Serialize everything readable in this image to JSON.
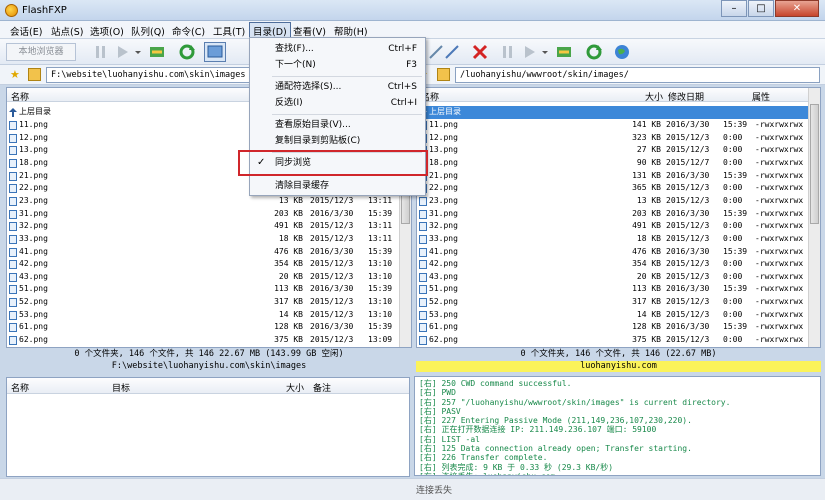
{
  "window": {
    "title": "FlashFXP"
  },
  "menu": [
    "会话(E)",
    "站点(S)",
    "选项(O)",
    "队列(Q)",
    "命令(C)",
    "工具(T)",
    "目录(D)",
    "查看(V)",
    "帮助(H)"
  ],
  "toolbar": {
    "local_browser_label": "本地浏览器"
  },
  "left": {
    "path": "F:\\website\\luohanyishu.com\\skin\\images",
    "col_name": "名称",
    "parent": "上层目录",
    "files": [
      {
        "name": "11.png",
        "size": "",
        "date": "",
        "time": ""
      },
      {
        "name": "12.png",
        "size": "",
        "date": "",
        "time": ""
      },
      {
        "name": "13.png",
        "size": "",
        "date": "",
        "time": ""
      },
      {
        "name": "18.png",
        "size": "",
        "date": "",
        "time": ""
      },
      {
        "name": "21.png",
        "size": "",
        "date": "",
        "time": ""
      },
      {
        "name": "22.png",
        "size": "",
        "date": "",
        "time": ""
      },
      {
        "name": "23.png",
        "size": "13 KB",
        "date": "2015/12/3",
        "time": "13:11"
      },
      {
        "name": "31.png",
        "size": "203 KB",
        "date": "2016/3/30",
        "time": "15:39"
      },
      {
        "name": "32.png",
        "size": "491 KB",
        "date": "2015/12/3",
        "time": "13:11"
      },
      {
        "name": "33.png",
        "size": "18 KB",
        "date": "2015/12/3",
        "time": "13:11"
      },
      {
        "name": "41.png",
        "size": "476 KB",
        "date": "2016/3/30",
        "time": "15:39"
      },
      {
        "name": "42.png",
        "size": "354 KB",
        "date": "2015/12/3",
        "time": "13:10"
      },
      {
        "name": "43.png",
        "size": "20 KB",
        "date": "2015/12/3",
        "time": "13:10"
      },
      {
        "name": "51.png",
        "size": "113 KB",
        "date": "2016/3/30",
        "time": "15:39"
      },
      {
        "name": "52.png",
        "size": "317 KB",
        "date": "2015/12/3",
        "time": "13:10"
      },
      {
        "name": "53.png",
        "size": "14 KB",
        "date": "2015/12/3",
        "time": "13:10"
      },
      {
        "name": "61.png",
        "size": "128 KB",
        "date": "2016/3/30",
        "time": "15:39"
      },
      {
        "name": "62.png",
        "size": "375 KB",
        "date": "2015/12/3",
        "time": "13:09"
      }
    ],
    "status1": "0 个文件夹, 146 个文件, 共 146 22.67 MB (143.99 GB 空闲)",
    "status2": "F:\\website\\luohanyishu.com\\skin\\images"
  },
  "right": {
    "path": "/luohanyishu/wwwroot/skin/images/",
    "col_name": "名称",
    "col_size": "大小",
    "col_date": "修改日期",
    "col_attr": "属性",
    "parent": "上层目录",
    "files": [
      {
        "name": "11.png",
        "size": "141 KB",
        "date": "2016/3/30",
        "time": "15:39",
        "attr": "-rwxrwxrwx"
      },
      {
        "name": "12.png",
        "size": "323 KB",
        "date": "2015/12/3",
        "time": "0:00",
        "attr": "-rwxrwxrwx"
      },
      {
        "name": "13.png",
        "size": "27 KB",
        "date": "2015/12/3",
        "time": "0:00",
        "attr": "-rwxrwxrwx"
      },
      {
        "name": "18.png",
        "size": "90 KB",
        "date": "2015/12/7",
        "time": "0:00",
        "attr": "-rwxrwxrwx"
      },
      {
        "name": "21.png",
        "size": "131 KB",
        "date": "2016/3/30",
        "time": "15:39",
        "attr": "-rwxrwxrwx"
      },
      {
        "name": "22.png",
        "size": "365 KB",
        "date": "2015/12/3",
        "time": "0:00",
        "attr": "-rwxrwxrwx"
      },
      {
        "name": "23.png",
        "size": "13 KB",
        "date": "2015/12/3",
        "time": "0:00",
        "attr": "-rwxrwxrwx"
      },
      {
        "name": "31.png",
        "size": "203 KB",
        "date": "2016/3/30",
        "time": "15:39",
        "attr": "-rwxrwxrwx"
      },
      {
        "name": "32.png",
        "size": "491 KB",
        "date": "2015/12/3",
        "time": "0:00",
        "attr": "-rwxrwxrwx"
      },
      {
        "name": "33.png",
        "size": "18 KB",
        "date": "2015/12/3",
        "time": "0:00",
        "attr": "-rwxrwxrwx"
      },
      {
        "name": "41.png",
        "size": "476 KB",
        "date": "2016/3/30",
        "time": "15:39",
        "attr": "-rwxrwxrwx"
      },
      {
        "name": "42.png",
        "size": "354 KB",
        "date": "2015/12/3",
        "time": "0:00",
        "attr": "-rwxrwxrwx"
      },
      {
        "name": "43.png",
        "size": "20 KB",
        "date": "2015/12/3",
        "time": "0:00",
        "attr": "-rwxrwxrwx"
      },
      {
        "name": "51.png",
        "size": "113 KB",
        "date": "2016/3/30",
        "time": "15:39",
        "attr": "-rwxrwxrwx"
      },
      {
        "name": "52.png",
        "size": "317 KB",
        "date": "2015/12/3",
        "time": "0:00",
        "attr": "-rwxrwxrwx"
      },
      {
        "name": "53.png",
        "size": "14 KB",
        "date": "2015/12/3",
        "time": "0:00",
        "attr": "-rwxrwxrwx"
      },
      {
        "name": "61.png",
        "size": "128 KB",
        "date": "2016/3/30",
        "time": "15:39",
        "attr": "-rwxrwxrwx"
      },
      {
        "name": "62.png",
        "size": "375 KB",
        "date": "2015/12/3",
        "time": "0:00",
        "attr": "-rwxrwxrwx"
      }
    ],
    "status1": "0 个文件夹, 146 个文件, 共 146 (22.67 MB)",
    "status2": "luohanyishu.com"
  },
  "queue": {
    "col_name": "名称",
    "col_target": "目标",
    "col_size": "大小",
    "col_note": "备注"
  },
  "log": [
    "[右] 250 CWD command successful.",
    "[右] PWD",
    "[右] 257 \"/luohanyishu/wwwroot/skin/images\" is current directory.",
    "[右] PASV",
    "[右] 227 Entering Passive Mode (211,149,236,107,230,220).",
    "[右] 正在打开数据连接 IP: 211.149.236.107 端口: 59100",
    "[右] LIST -al",
    "[右] 125 Data connection already open; Transfer starting.",
    "[右] 226 Transfer complete.",
    "[右] 列表完成: 9 KB 于 0.33 秒 (29.3 KB/秒)",
    "[右] 连接丢失: luohanyishu.com"
  ],
  "bottom_status": "连接丢失",
  "dropdown": {
    "items": [
      {
        "label": "查找(F)...",
        "shortcut": "Ctrl+F"
      },
      {
        "label": "下一个(N)",
        "shortcut": "F3"
      },
      {
        "label": "通配符选择(S)...",
        "shortcut": "Ctrl+S"
      },
      {
        "label": "反选(I)",
        "shortcut": "Ctrl+I"
      },
      {
        "label": "查看原始目录(V)...",
        "shortcut": ""
      },
      {
        "label": "复制目录到剪贴板(C)",
        "shortcut": ""
      },
      {
        "label": "同步浏览",
        "shortcut": "",
        "checked": true
      },
      {
        "label": "清除目录缓存",
        "shortcut": ""
      }
    ]
  },
  "colors": {
    "selection": "#3c88d9",
    "log_text": "#18894a",
    "highlight_border": "#d0262b",
    "right_status_bg": "#fbf35a"
  }
}
